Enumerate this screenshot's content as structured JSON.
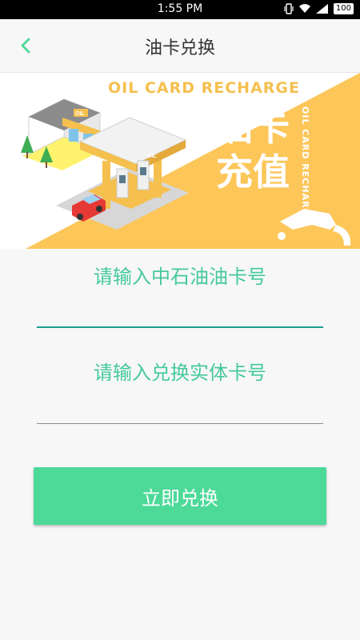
{
  "status_bar": {
    "time": "1:55 PM",
    "battery": "100"
  },
  "app_bar": {
    "title": "油卡兑换"
  },
  "banner": {
    "title_en": "OIL CARD RECHARGE",
    "title_cn": "油卡充值",
    "title_en_vertical": "OIL CARD RECHARGE",
    "sign_text": "OIL",
    "accent_color": "#fcc659"
  },
  "form": {
    "card_number_placeholder": "请输入中石油油卡号",
    "exchange_card_placeholder": "请输入兑换实体卡号",
    "submit_label": "立即兑换"
  },
  "colors": {
    "primary": "#4dd998",
    "hint": "#45c99b",
    "focused_underline": "#1a9e8c"
  }
}
